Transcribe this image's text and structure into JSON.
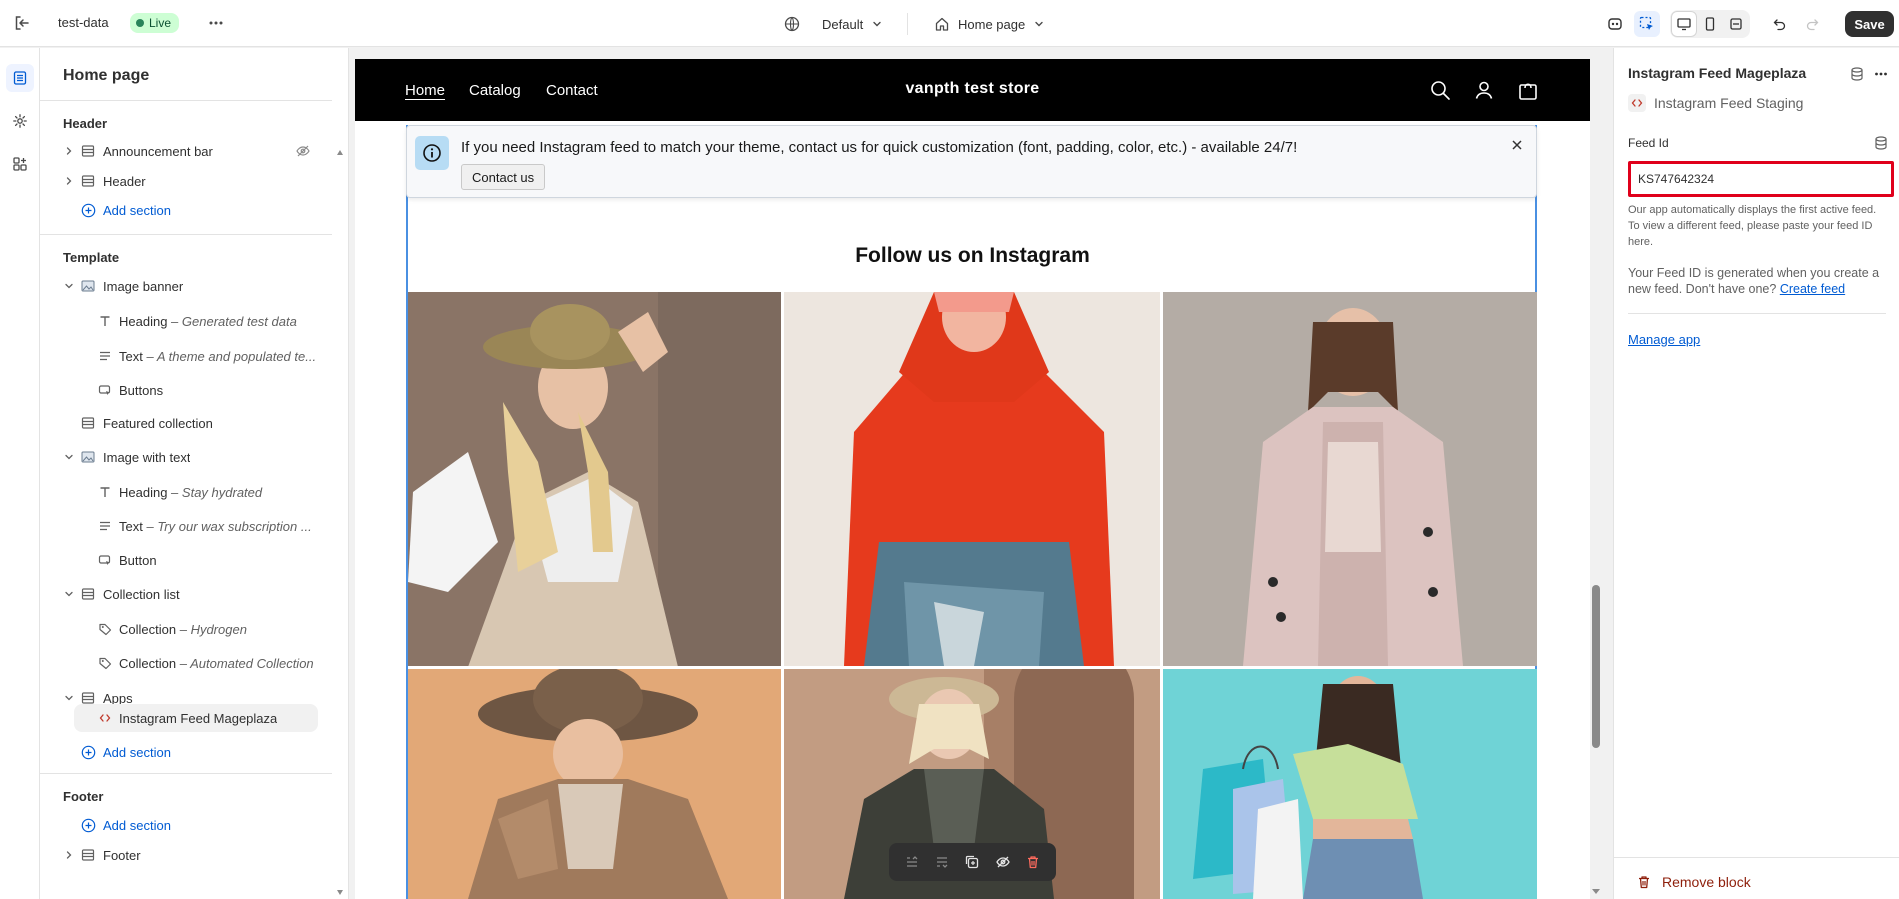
{
  "topbar": {
    "store_name": "test-data",
    "status": "Live",
    "theme": "Default",
    "page": "Home page",
    "save_label": "Save"
  },
  "sidebar": {
    "title": "Home page",
    "header_group": "Header",
    "header_items": [
      "Announcement bar",
      "Header"
    ],
    "add_section": "Add section",
    "template_group": "Template",
    "image_banner": "Image banner",
    "image_banner_blocks": [
      {
        "label": "Heading",
        "detail": "Generated test data"
      },
      {
        "label": "Text",
        "detail": "A theme and populated te..."
      },
      {
        "label": "Buttons",
        "detail": ""
      }
    ],
    "featured_collection": "Featured collection",
    "image_with_text": "Image with text",
    "image_with_text_blocks": [
      {
        "label": "Heading",
        "detail": "Stay hydrated"
      },
      {
        "label": "Text",
        "detail": "Try our wax subscription ..."
      },
      {
        "label": "Button",
        "detail": ""
      }
    ],
    "collection_list": "Collection list",
    "collection_list_blocks": [
      {
        "label": "Collection",
        "detail": "Hydrogen"
      },
      {
        "label": "Collection",
        "detail": "Automated Collection"
      }
    ],
    "apps": "Apps",
    "apps_block": "Instagram Feed Mageplaza",
    "footer_group": "Footer",
    "footer_item": "Footer",
    "dash": " – "
  },
  "preview": {
    "nav_links": [
      "Home",
      "Catalog",
      "Contact"
    ],
    "store_title": "vanpth test store",
    "notice_text": "If you need Instagram feed to match your theme, contact us for quick customization (font, padding, color, etc.) - available 24/7!",
    "contact_button": "Contact us",
    "feed_heading": "Follow us on Instagram"
  },
  "settings": {
    "title": "Instagram Feed Mageplaza",
    "subtitle": "Instagram Feed Staging",
    "feed_id_label": "Feed Id",
    "feed_id_value": "KS747642324",
    "help_text": "Our app automatically displays the first active feed. To view a different feed, please paste your feed ID here.",
    "help_text2": "Your Feed ID is generated when you create a new feed. Don't have one?",
    "create_feed_link": "Create feed",
    "manage_app": "Manage app",
    "remove_block": "Remove block"
  },
  "colors": {
    "accent": "#005bd3",
    "danger": "#8e1f0b",
    "live_badge": "#cdfed4",
    "highlight_border": "#e0001b",
    "selection_border": "#4a90e2"
  }
}
